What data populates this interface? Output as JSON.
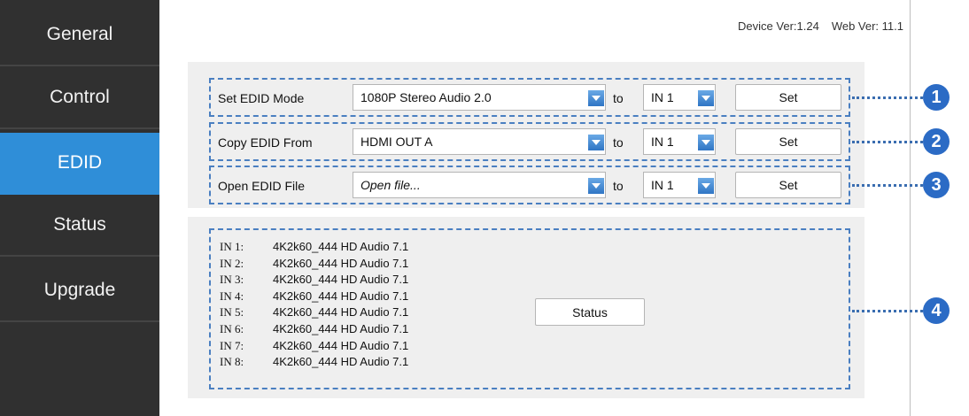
{
  "sidebar": {
    "items": [
      {
        "label": "General",
        "active": false
      },
      {
        "label": "Control",
        "active": false
      },
      {
        "label": "EDID",
        "active": true
      },
      {
        "label": "Status",
        "active": false
      },
      {
        "label": "Upgrade",
        "active": false
      }
    ]
  },
  "header": {
    "device_version": "Device Ver:1.24",
    "web_version": "Web Ver: 11.1"
  },
  "edid": {
    "rows": [
      {
        "label": "Set EDID Mode",
        "source_value": "1080P Stereo Audio 2.0",
        "to_label": "to",
        "target_value": "IN 1",
        "button_label": "Set"
      },
      {
        "label": "Copy EDID From",
        "source_value": "HDMI OUT A",
        "to_label": "to",
        "target_value": "IN 1",
        "button_label": "Set"
      },
      {
        "label": "Open EDID File",
        "source_value": "Open file...",
        "to_label": "to",
        "target_value": "IN 1",
        "button_label": "Set"
      }
    ]
  },
  "status_panel": {
    "lines": [
      {
        "port": "IN 1:",
        "value": "4K2k60_444 HD Audio 7.1"
      },
      {
        "port": "IN 2:",
        "value": "4K2k60_444 HD Audio 7.1"
      },
      {
        "port": "IN 3:",
        "value": "4K2k60_444 HD Audio 7.1"
      },
      {
        "port": "IN 4:",
        "value": "4K2k60_444 HD Audio 7.1"
      },
      {
        "port": "IN 5:",
        "value": "4K2k60_444 HD Audio 7.1"
      },
      {
        "port": "IN 6:",
        "value": "4K2k60_444 HD Audio 7.1"
      },
      {
        "port": "IN 7:",
        "value": "4K2k60_444 HD Audio 7.1"
      },
      {
        "port": "IN 8:",
        "value": "4K2k60_444 HD Audio 7.1"
      }
    ],
    "button_label": "Status"
  },
  "callouts": [
    "1",
    "2",
    "3",
    "4"
  ],
  "colors": {
    "sidebar_bg": "#303030",
    "active_bg": "#2f8ed8",
    "panel_bg": "#efefef",
    "accent": "#2b6bc5"
  },
  "icons": {
    "dropdown": "chevron-down-icon"
  }
}
